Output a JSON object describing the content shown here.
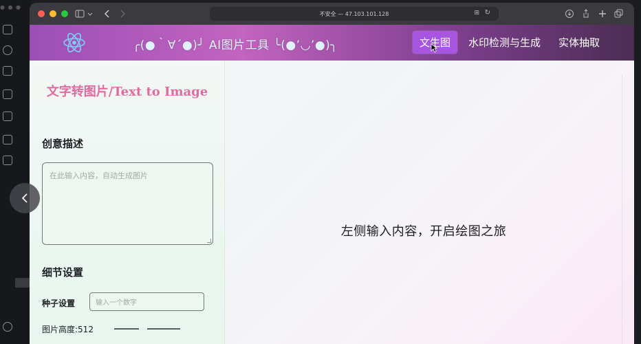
{
  "browser": {
    "url": "不安全 — 47.103.101.128",
    "traffic_colors": [
      "#ff5f57",
      "#febc2e",
      "#28c840"
    ]
  },
  "app": {
    "title": "╭(●｀∀´●)╯ AI图片工具 ╰(●’◡’●)╮",
    "nav": [
      {
        "label": "文生图",
        "active": true
      },
      {
        "label": "水印检测与生成",
        "active": false
      },
      {
        "label": "实体抽取",
        "active": false
      }
    ],
    "accent": "#a855e0"
  },
  "left_panel": {
    "title": "文字转图片/Text to Image",
    "creative_section": "创意描述",
    "prompt_placeholder": "在此输入内容，自动生成图片",
    "detail_section": "细节设置",
    "seed_label": "种子设置",
    "seed_placeholder": "输入一个数字",
    "height_label": "图片高度:512"
  },
  "main_panel": {
    "empty_message": "左侧输入内容，开启绘图之旅"
  }
}
